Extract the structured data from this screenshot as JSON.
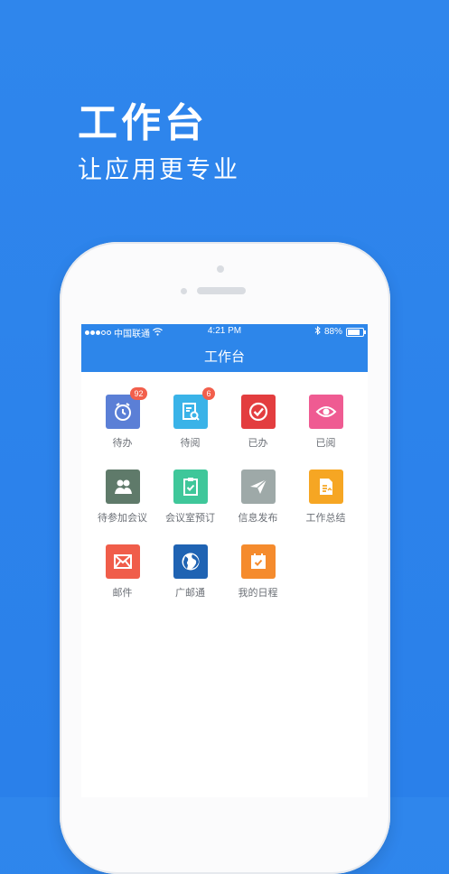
{
  "hero": {
    "title": "工作台",
    "subtitle": "让应用更专业"
  },
  "statusbar": {
    "carrier": "中国联通",
    "time": "4:21 PM",
    "battery": "88%",
    "battery_level": 0.88
  },
  "navbar": {
    "title": "工作台"
  },
  "apps": [
    {
      "label": "待办",
      "icon": "clock-icon",
      "color": "#5b7fd6",
      "badge": "92"
    },
    {
      "label": "待阅",
      "icon": "document-search-icon",
      "color": "#3ab3e8",
      "badge": "6"
    },
    {
      "label": "已办",
      "icon": "check-circle-icon",
      "color": "#e33d3f"
    },
    {
      "label": "已阅",
      "icon": "eye-icon",
      "color": "#ef5b92"
    },
    {
      "label": "待参加会议",
      "icon": "people-icon",
      "color": "#5f7a6a"
    },
    {
      "label": "会议室预订",
      "icon": "clipboard-check-icon",
      "color": "#3fc79a"
    },
    {
      "label": "信息发布",
      "icon": "paper-plane-icon",
      "color": "#9ea9a8"
    },
    {
      "label": "工作总结",
      "icon": "report-icon",
      "color": "#f6a623"
    },
    {
      "label": "邮件",
      "icon": "mail-icon",
      "color": "#f05d4a"
    },
    {
      "label": "广邮通",
      "icon": "globe-icon",
      "color": "#1f63b3"
    },
    {
      "label": "我的日程",
      "icon": "calendar-check-icon",
      "color": "#f58b2d"
    }
  ]
}
